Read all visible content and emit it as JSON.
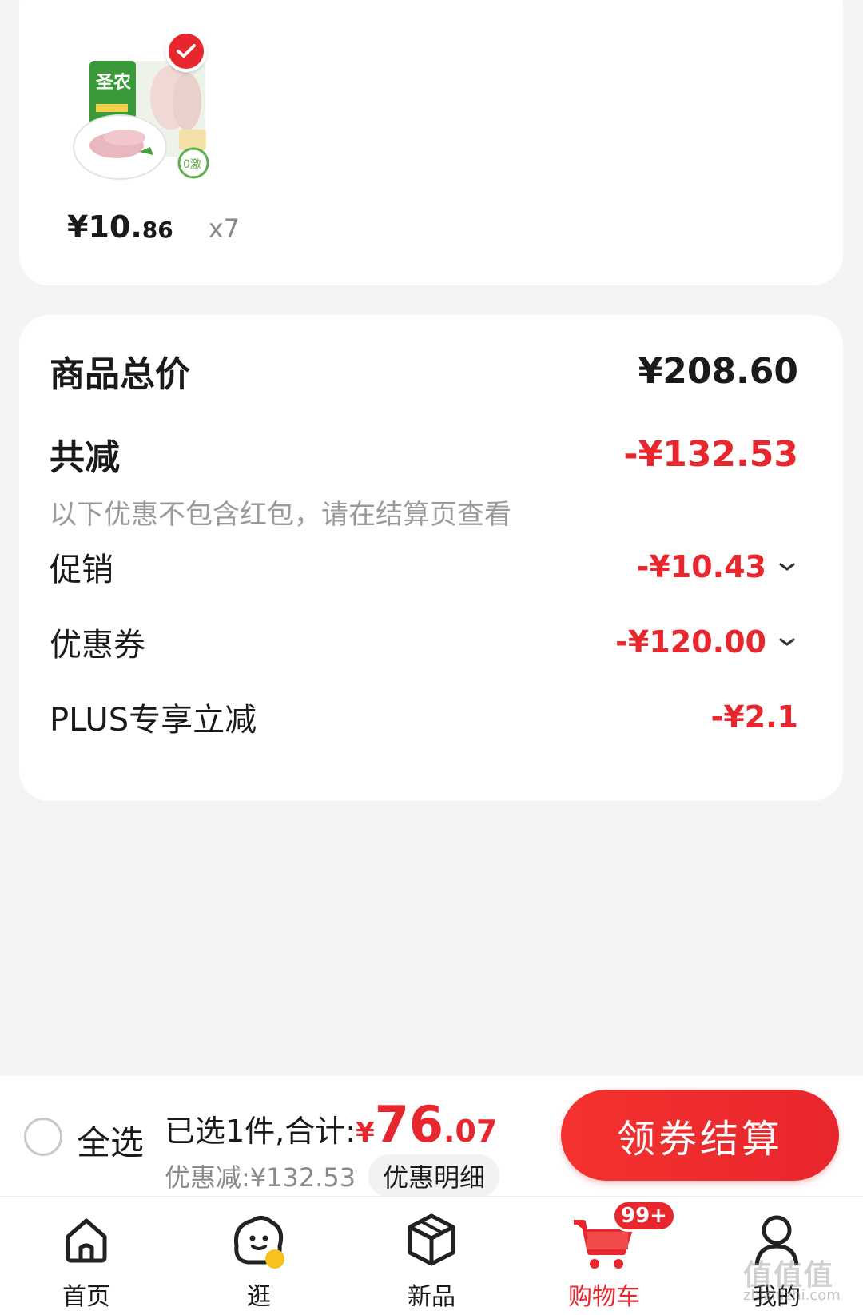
{
  "product": {
    "image_icon": "chicken-wings-package-image",
    "price_int": "¥10.",
    "price_dec": "86",
    "quantity": "x7",
    "selected": true
  },
  "summary": {
    "total_label": "商品总价",
    "total_value": "¥208.60",
    "discount_label": "共减",
    "discount_value": "-¥132.53",
    "hint": "以下优惠不包含红包，请在结算页查看",
    "promo_label": "促销",
    "promo_value": "-¥10.43",
    "coupon_label": "优惠券",
    "coupon_value": "-¥120.00",
    "plus_label": "PLUS专享立减",
    "plus_value": "-¥2.1"
  },
  "checkout": {
    "select_all": "全选",
    "selected_summary": "已选1件,合计:",
    "yen": "¥",
    "total_int": "76",
    "total_dec": ".07",
    "discount_text": "优惠减:¥132.53",
    "detail_button": "优惠明细",
    "checkout_button": "领券结算"
  },
  "tabs": [
    {
      "label": "首页",
      "icon": "home-icon"
    },
    {
      "label": "逛",
      "icon": "stroll-icon"
    },
    {
      "label": "新品",
      "icon": "new-products-icon"
    },
    {
      "label": "购物车",
      "icon": "cart-icon",
      "badge": "99+",
      "active": true
    },
    {
      "label": "我的",
      "icon": "profile-icon"
    }
  ],
  "watermark": {
    "text": "值值值",
    "sub": "zhizhizhi.com"
  },
  "colors": {
    "accent": "#e8262d",
    "background": "#f4f4f5"
  }
}
